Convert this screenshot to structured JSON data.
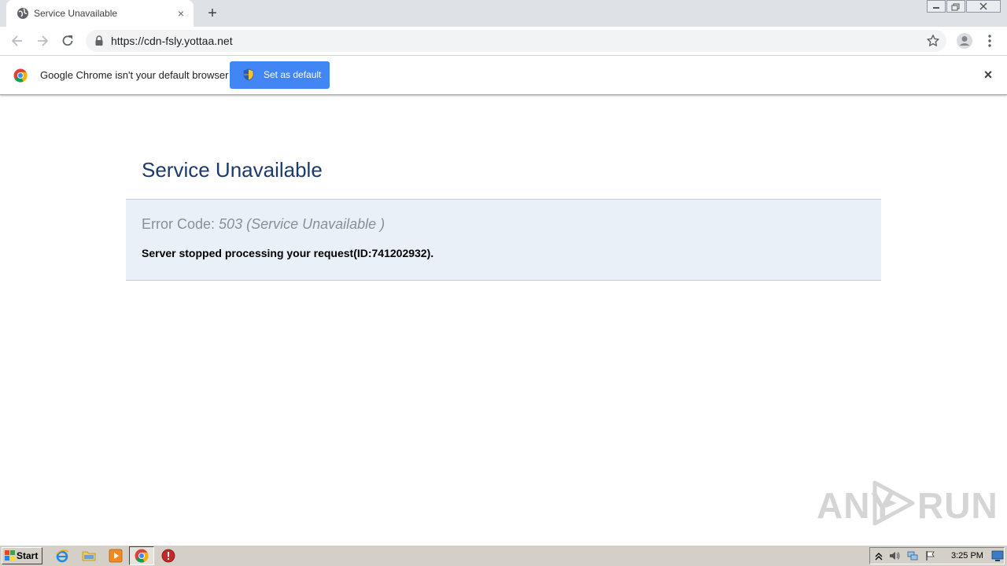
{
  "browser": {
    "tab": {
      "title": "Service Unavailable",
      "close_glyph": "×"
    },
    "new_tab_glyph": "+",
    "address_bar": {
      "url": "https://cdn-fsly.yottaa.net"
    },
    "icons": {
      "back": "arrow-left-icon",
      "forward": "arrow-right-icon",
      "reload": "reload-icon",
      "lock": "lock-icon",
      "bookmark": "star-icon",
      "profile": "avatar-icon",
      "menu": "kebab-menu-icon"
    }
  },
  "infobar": {
    "message": "Google Chrome isn't your default browser",
    "button_label": "Set as default",
    "close_glyph": "×"
  },
  "page": {
    "title": "Service Unavailable",
    "error_label": "Error Code: ",
    "error_code": "503 (Service Unavailable )",
    "message": "Server stopped processing your request(ID:741202932)."
  },
  "watermark": {
    "left": "ANY",
    "right": "RUN"
  },
  "taskbar": {
    "start_label": "Start",
    "clock": "3:25 PM"
  },
  "colors": {
    "title_blue": "#1c3a6b",
    "error_box_bg": "#eaf0f8",
    "button_blue": "#4285f4",
    "tab_strip": "#dee1e6",
    "taskbar": "#d4d0c8"
  }
}
